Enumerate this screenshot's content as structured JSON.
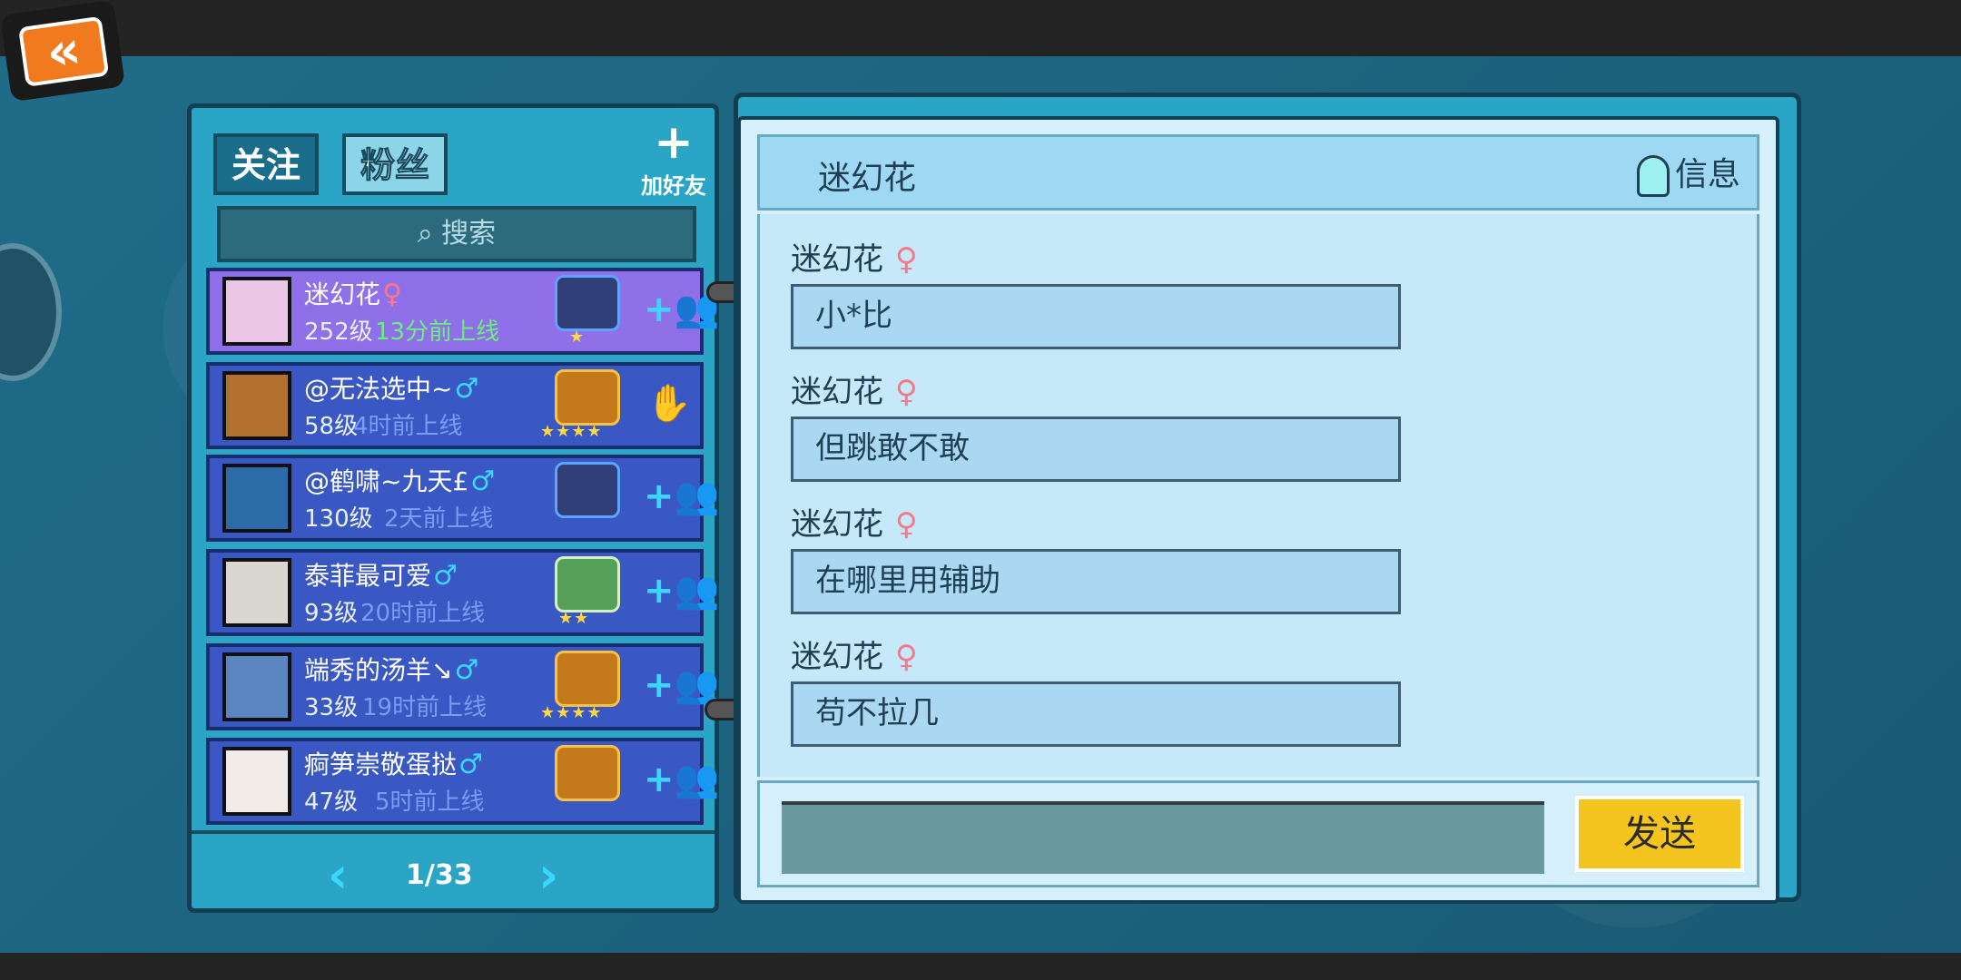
{
  "tabs": {
    "follow": "关注",
    "fans": "粉丝"
  },
  "add_friend": {
    "icon": "+",
    "label": "加好友"
  },
  "search": {
    "label": "搜索"
  },
  "friends": [
    {
      "name": "迷幻花",
      "gender": "♀",
      "level": "252级",
      "status": "13分前上线",
      "stars": "★",
      "rank_icon": "rank-badge-icon"
    },
    {
      "name": "@无法选中~",
      "gender": "♂",
      "level": "58级",
      "status": "4时前上线",
      "stars": "★★★★",
      "rank_icon": "rank-badge-icon"
    },
    {
      "name": "@鹤啸~九天£",
      "gender": "♂",
      "level": "130级",
      "status": "2天前上线",
      "stars": "",
      "rank_icon": "rank-badge-icon"
    },
    {
      "name": "泰菲最可爱",
      "gender": "♂",
      "level": "93级",
      "status": "20时前上线",
      "stars": "★★",
      "rank_icon": "rank-badge-icon"
    },
    {
      "name": "端秀的汤羊↘",
      "gender": "♂",
      "level": "33级",
      "status": "19时前上线",
      "stars": "★★★★",
      "rank_icon": "rank-badge-icon"
    },
    {
      "name": "痾笋崇敬蛋挞",
      "gender": "♂",
      "level": "47级",
      "status": "5时前上线",
      "stars": "",
      "rank_icon": "rank-badge-icon"
    }
  ],
  "pager": {
    "label": "1/33"
  },
  "chat": {
    "title": "迷幻花",
    "info_label": "信息",
    "messages": [
      {
        "sender": "迷幻花",
        "gender": "♀",
        "text": "小*比"
      },
      {
        "sender": "迷幻花",
        "gender": "♀",
        "text": "但跳敢不敢"
      },
      {
        "sender": "迷幻花",
        "gender": "♀",
        "text": "在哪里用辅助"
      },
      {
        "sender": "迷幻花",
        "gender": "♀",
        "text": "苟不拉几"
      }
    ],
    "input_value": "",
    "send_label": "发送"
  },
  "icons": {
    "back": "double-chevron-left-icon",
    "add_friend": "add-user-icon",
    "search": "search-icon",
    "info": "person-icon",
    "handshake": "handshake-icon"
  },
  "colors": {
    "panel": "#2ba5c6",
    "selected_row": "#8f70e9",
    "row": "#3958c4",
    "send": "#f3c51e",
    "female": "#f6798b",
    "male": "#3ad7ff"
  }
}
